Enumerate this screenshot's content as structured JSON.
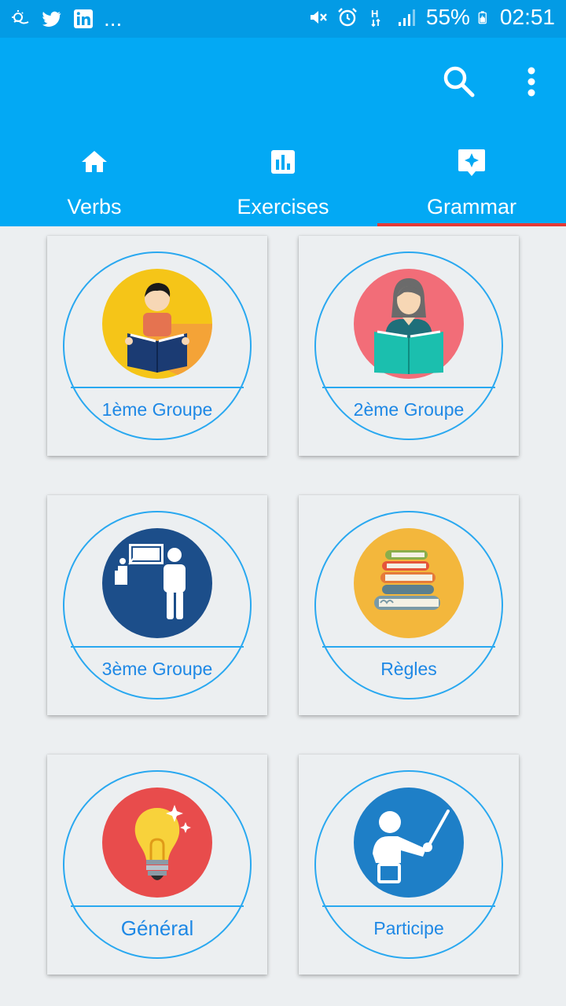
{
  "status_bar": {
    "battery": "55%",
    "time": "02:51",
    "more": "...",
    "left_icons": [
      "weather-icon",
      "twitter-icon",
      "linkedin-icon"
    ],
    "right_icons": [
      "mute-icon",
      "alarm-icon",
      "network-h-icon",
      "signal-icon",
      "battery-icon"
    ]
  },
  "toolbar": {
    "actions": [
      "search-icon",
      "more-vert-icon"
    ]
  },
  "tabs": [
    {
      "label": "Verbs",
      "icon": "home-icon",
      "active": false
    },
    {
      "label": "Exercises",
      "icon": "bar-chart-icon",
      "active": false
    },
    {
      "label": "Grammar",
      "icon": "sparkle-bubble-icon",
      "active": true
    }
  ],
  "cards": [
    {
      "label": "1ème Groupe",
      "icon": "reading-boy-icon",
      "color": "#f5c518"
    },
    {
      "label": "2ème Groupe",
      "icon": "reading-woman-icon",
      "color": "#f26d78"
    },
    {
      "label": "3ème Groupe",
      "icon": "teacher-board-icon",
      "color": "#1c4e8a"
    },
    {
      "label": "Règles",
      "icon": "book-stack-icon",
      "color": "#f3b73c"
    },
    {
      "label": "Général",
      "icon": "lightbulb-icon",
      "color": "#e84c4c"
    },
    {
      "label": "Participe",
      "icon": "pointer-teacher-icon",
      "color": "#1e7fc7"
    }
  ],
  "colors": {
    "primary": "#03a9f4",
    "status_bar": "#039be5",
    "accent_underline": "#e53935",
    "card_text": "#1e88e5"
  }
}
